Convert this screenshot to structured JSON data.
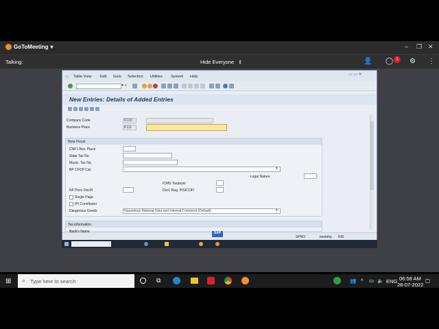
{
  "gtm": {
    "app_name": "GoToMeeting",
    "talking_label": "Talking:",
    "hide_everyone_label": "Hide Everyone",
    "chat_badge": "1"
  },
  "sap": {
    "menu": [
      "Table View",
      "Edit",
      "Goto",
      "Selection",
      "Utilities",
      "System",
      "Help"
    ],
    "screen_title": "New Entries: Details of Added Entries",
    "fields": {
      "company_code_label": "Company Code",
      "company_code_value": "K100",
      "business_place_label": "Business Place",
      "business_place_value": "K111"
    },
    "nota_fiscal": {
      "header": "Nota Fiscal",
      "cnpj_label": "CNPJ Bus. Place",
      "state_tax_label": "State Tax No.",
      "munic_tax_label": "Munic. Tax No.",
      "bp_cfop_label": "BP CFOP Cat.",
      "legal_nature_label": "Legal Nature",
      "icms_label": "ICMS Taxpayer",
      "nf_price_label": "NF Price DecPl.",
      "decl_reg_label": "Decl. Reg. PIS/COFI",
      "single_page_label": "Single Page",
      "ipi_label": "IPI Contributor",
      "dangerous_goods_label": "Dangerous Goods",
      "dangerous_goods_value": "Hazardous Material Data and Internal Comment (Default)"
    },
    "tax_info": {
      "header": "Tax information",
      "bank_name_label": "Bank's Name"
    },
    "status": {
      "system": "SPRO",
      "client": "bestehp",
      "mode": "INS"
    }
  },
  "taskbar": {
    "search_placeholder": "Type here to search",
    "time": "06:58 AM",
    "date": "28-07-2022",
    "language": "ENG"
  }
}
